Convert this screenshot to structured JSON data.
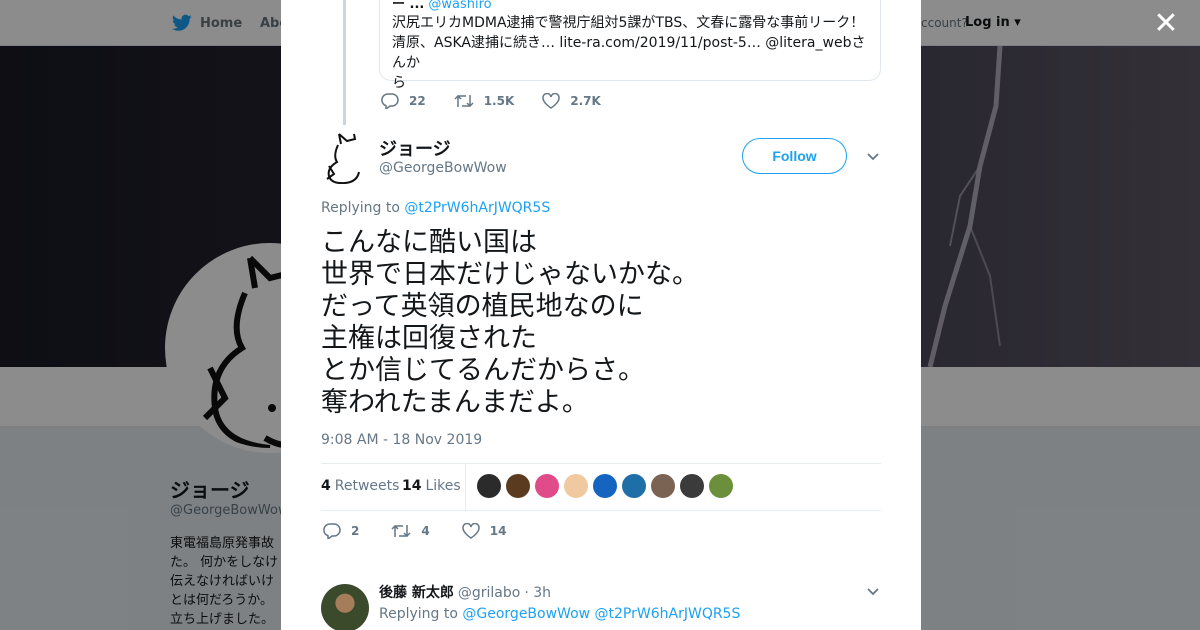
{
  "background": {
    "nav": {
      "home_label": "Home",
      "about_label": "Abo",
      "account_prompt": "ccount?",
      "login_label": "Log in"
    },
    "profile": {
      "name": "ジョージ",
      "handle": "@GeorgeBowWow",
      "bio_lines": [
        "東電福島原発事故",
        "た。 何かをしなけ",
        "伝えなければいけ",
        "とは何だろうか。",
        "立ち上げました。"
      ]
    }
  },
  "modal": {
    "quoted": {
      "author_partial": "ー ...",
      "handle_partial": "@washiro",
      "text_lines": [
        "沢尻エリカMDMA逮捕で警視庁組対5課がTBS、文春に露骨な事前リーク！",
        "清原、ASKA逮捕に続き… lite-ra.com/2019/11/post-5… @litera_webさんか",
        "ら"
      ]
    },
    "previous_actions": {
      "replies": "22",
      "retweets": "1.5K",
      "likes": "2.7K"
    },
    "tweet": {
      "author_name": "ジョージ",
      "author_handle": "@GeorgeBowWow",
      "follow_label": "Follow",
      "replying_prefix": "Replying to",
      "replying_mention": "@t2PrW6hArJWQR5S",
      "body_lines": [
        "こんなに酷い国は",
        "世界で日本だけじゃないかな。",
        "だって英領の植民地なのに",
        "主権は回復された",
        "とか信じてるんだからさ。",
        "奪われたまんまだよ。"
      ],
      "timestamp": "9:08 AM - 18 Nov 2019",
      "retweets_count": "4",
      "retweets_label": "Retweets",
      "likes_count": "14",
      "likes_label": "Likes",
      "liker_colors": [
        "#2b2b2b",
        "#5a3b1f",
        "#e04b8a",
        "#f0c9a0",
        "#1565c0",
        "#1e6fa8",
        "#7a6352",
        "#3b3b3b",
        "#6b8f3a"
      ],
      "actions": {
        "replies": "2",
        "retweets": "4",
        "likes": "14"
      }
    },
    "reply": {
      "author_name": "後藤 新太郎",
      "author_handle": "@grilabo",
      "time": "· 3h",
      "replying_prefix": "Replying to",
      "replying_mentions": "@GeorgeBowWow @t2PrW6hArJWQR5S"
    }
  },
  "colors": {
    "accent": "#1da1f2",
    "text": "#14171a",
    "muted": "#657786",
    "overlay": "rgba(0,0,0,0.45)"
  },
  "icons": [
    "twitter-bird-icon",
    "close-icon",
    "reply-icon",
    "retweet-icon",
    "like-icon",
    "chevron-down-icon"
  ]
}
